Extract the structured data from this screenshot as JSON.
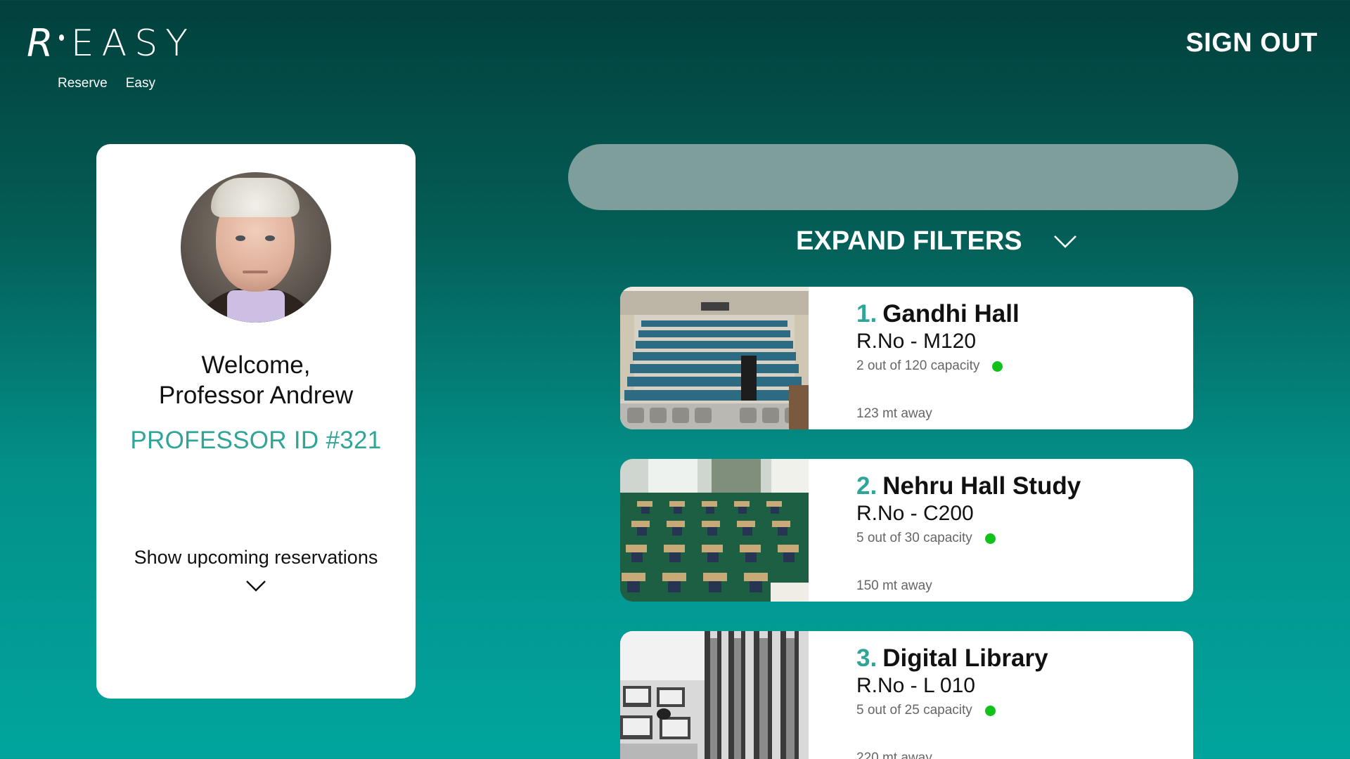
{
  "brand": {
    "logo_letter": "R",
    "logo_word": "EASY",
    "tagline_1": "Reserve",
    "tagline_2": "Easy"
  },
  "header": {
    "sign_out_label": "SIGN OUT"
  },
  "profile": {
    "welcome_line1": "Welcome,",
    "welcome_line2": "Professor Andrew",
    "professor_id": "PROFESSOR ID #321",
    "upcoming_label": "Show upcoming reservations"
  },
  "search": {
    "placeholder": "",
    "value": ""
  },
  "filters": {
    "label": "EXPAND FILTERS"
  },
  "results": [
    {
      "number": "1.",
      "name": "Gandhi Hall",
      "room": "R.No - M120",
      "capacity": "2 out of 120 capacity",
      "distance": "123 mt away",
      "status_color": "#12c21a"
    },
    {
      "number": "2.",
      "name": "Nehru Hall Study",
      "room": "R.No - C200",
      "capacity": "5 out of 30 capacity",
      "distance": "150 mt away",
      "status_color": "#12c21a"
    },
    {
      "number": "3.",
      "name": "Digital Library",
      "room": "R.No - L 010",
      "capacity": "5 out of 25 capacity",
      "distance": "220 mt away",
      "status_color": "#12c21a"
    }
  ],
  "colors": {
    "accent": "#2fa598",
    "status_available": "#12c21a",
    "search_bar": "#7d9e9a"
  }
}
